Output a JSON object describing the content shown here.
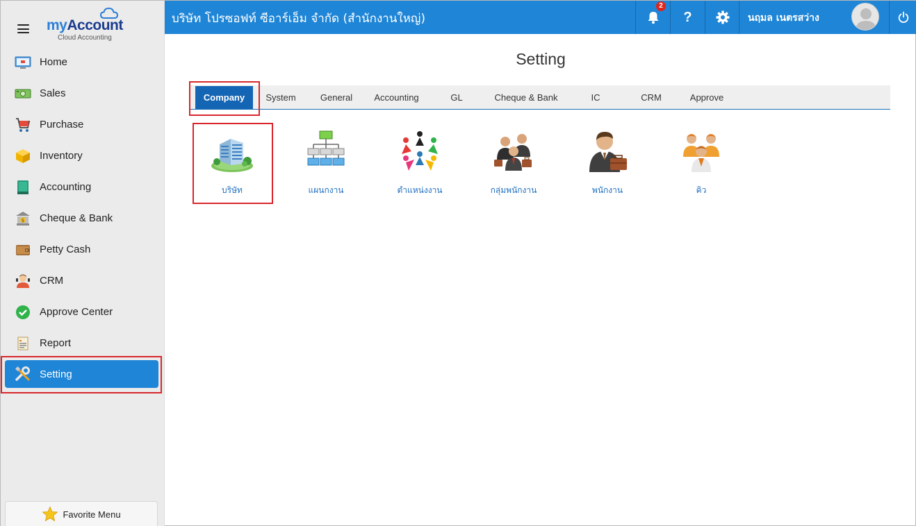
{
  "sidebar": {
    "logo": {
      "brand_my": "my",
      "brand_account": "Account",
      "subtitle": "Cloud Accounting"
    },
    "items": [
      {
        "label": "Home"
      },
      {
        "label": "Sales"
      },
      {
        "label": "Purchase"
      },
      {
        "label": "Inventory"
      },
      {
        "label": "Accounting"
      },
      {
        "label": "Cheque & Bank"
      },
      {
        "label": "Petty Cash"
      },
      {
        "label": "CRM"
      },
      {
        "label": "Approve Center"
      },
      {
        "label": "Report"
      },
      {
        "label": "Setting"
      }
    ],
    "favorite_label": "Favorite Menu"
  },
  "topbar": {
    "company": "บริษัท โปรซอฟท์ ซีอาร์เอ็ม จำกัด (สำนักงานใหญ่)",
    "notification_count": "2",
    "help_label": "?",
    "user_name": "นฤมล เนตรสว่าง"
  },
  "main": {
    "title": "Setting",
    "tabs": [
      {
        "label": "Company"
      },
      {
        "label": "System"
      },
      {
        "label": "General"
      },
      {
        "label": "Accounting"
      },
      {
        "label": "GL"
      },
      {
        "label": "Cheque & Bank"
      },
      {
        "label": "IC"
      },
      {
        "label": "CRM"
      },
      {
        "label": "Approve"
      }
    ],
    "tiles": [
      {
        "label": "บริษัท"
      },
      {
        "label": "แผนกงาน"
      },
      {
        "label": "ตำแหน่งงาน"
      },
      {
        "label": "กลุ่มพนักงาน"
      },
      {
        "label": "พนักงาน"
      },
      {
        "label": "คิว"
      }
    ]
  },
  "colors": {
    "primary": "#1f85d6",
    "tab_active": "#1565b5",
    "highlight_border": "#d8262c",
    "sidebar_bg": "#ebebeb"
  }
}
